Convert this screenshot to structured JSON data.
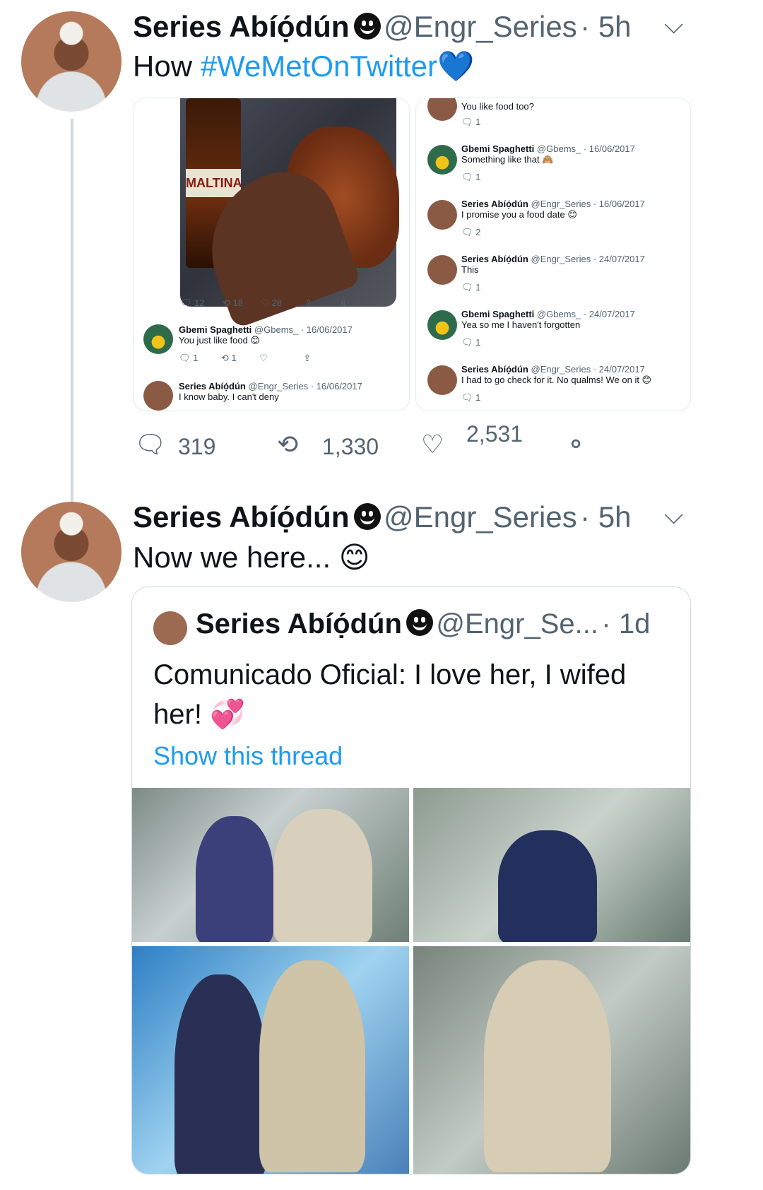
{
  "tweet1": {
    "name": "Series Abíọ́dún",
    "handle": "@Engr_Series",
    "time": "· 5h",
    "text_prefix": "How",
    "hashtag": "#WeMetOnTwitter",
    "emoji": "💙",
    "stats": {
      "replies": "319",
      "retweets": "1,330",
      "likes": "2,531"
    }
  },
  "left_shot": {
    "bottle_label": "MALTINA",
    "actions": {
      "replies": "12",
      "retweets": "18",
      "likes": "28"
    },
    "replies": [
      {
        "name": "Gbemi Spaghetti",
        "meta": "@Gbems_ · 16/06/2017",
        "text": "You just like food 😊",
        "reply_count": "1",
        "rt_count": "1"
      },
      {
        "name": "Series Abíọ́dún",
        "meta": "@Engr_Series · 16/06/2017",
        "text": "I know baby.  I can't deny"
      }
    ]
  },
  "right_shot": {
    "top_text": "You like food too?",
    "top_reply_count": "1",
    "replies": [
      {
        "name": "Gbemi Spaghetti",
        "meta": "@Gbems_ · 16/06/2017",
        "text": "Something like that 🙈",
        "count": "1"
      },
      {
        "name": "Series Abíọ́dún",
        "meta": "@Engr_Series · 16/06/2017",
        "text": "I promise you a food date 😊",
        "count": "2"
      },
      {
        "name": "Series Abíọ́dún",
        "meta": "@Engr_Series · 24/07/2017",
        "text": "This",
        "count": "1"
      },
      {
        "name": "Gbemi Spaghetti",
        "meta": "@Gbems_ · 24/07/2017",
        "text": "Yea so me I haven't forgotten",
        "count": "1"
      },
      {
        "name": "Series Abíọ́dún",
        "meta": "@Engr_Series · 24/07/2017",
        "text": "I had to go check for it. No qualms! We on it 😊",
        "count": "1"
      }
    ]
  },
  "tweet2": {
    "name": "Series Abíọ́dún",
    "handle": "@Engr_Series",
    "time": "· 5h",
    "text": "Now we here... 😊"
  },
  "quote": {
    "name": "Series Abíọ́dún",
    "handle": "@Engr_Se...",
    "time": "· 1d",
    "text": "Comunicado Oficial: I love her, I wifed her! 💞",
    "show_thread": "Show this thread"
  },
  "icons": [
    "chevron-down-icon",
    "reply-icon",
    "retweet-icon",
    "like-icon",
    "share-icon",
    "analytics-icon"
  ],
  "colors": {
    "accent": "#1d9bf0",
    "secondary_text": "#536471",
    "thread_line": "#cfd9de"
  }
}
